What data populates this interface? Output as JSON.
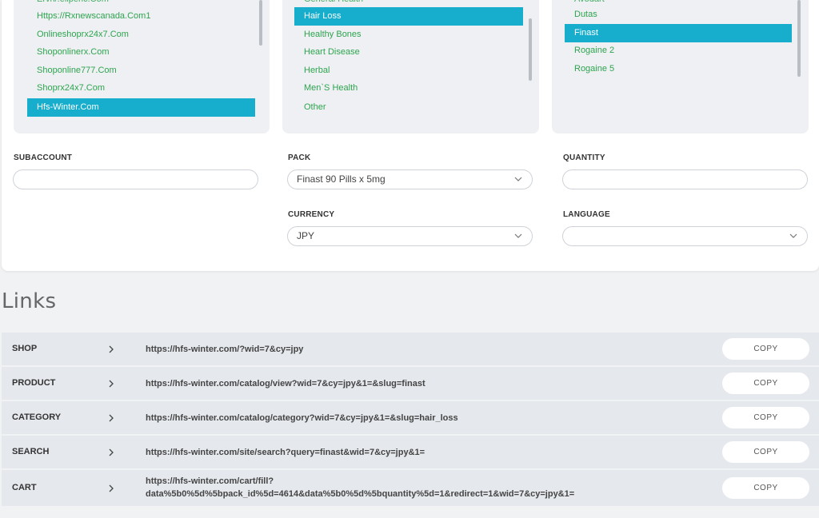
{
  "lists": {
    "shops": {
      "items": [
        "Https://Rxnewscanada.Com1",
        "Onlineshoprx24x7.Com",
        "Shoponlinerx.Com",
        "Shoponline777.Com",
        "Shoprx24x7.Com",
        "Hfs-Winter.Com"
      ],
      "selected": "Hfs-Winter.Com"
    },
    "categories": {
      "items": [
        "Hair Loss",
        "Healthy Bones",
        "Heart Disease",
        "Herbal",
        "Men`S Health",
        "Other"
      ],
      "selected": "Hair Loss"
    },
    "products": {
      "items": [
        "Dutas",
        "Finast",
        "Rogaine 2",
        "Rogaine 5"
      ],
      "selected": "Finast"
    }
  },
  "form": {
    "subaccount": {
      "label": "SUBACCOUNT",
      "value": ""
    },
    "pack": {
      "label": "PACK",
      "value": "Finast 90 Pills x 5mg"
    },
    "quantity": {
      "label": "QUANTITY",
      "value": ""
    },
    "currency": {
      "label": "CURRENCY",
      "value": "JPY"
    },
    "language": {
      "label": "LANGUAGE",
      "value": ""
    }
  },
  "links": {
    "title": "Links",
    "copy_label": "COPY",
    "rows": [
      {
        "name": "SHOP",
        "url_lines": [
          "https://hfs-winter.com/?wid=7&cy=jpy"
        ]
      },
      {
        "name": "PRODUCT",
        "url_lines": [
          "https://hfs-winter.com/catalog/view?wid=7&cy=jpy&1=&slug=finast"
        ]
      },
      {
        "name": "CATEGORY",
        "url_lines": [
          "https://hfs-winter.com/catalog/category?wid=7&cy=jpy&1=&slug=hair_loss"
        ]
      },
      {
        "name": "SEARCH",
        "url_lines": [
          "https://hfs-winter.com/site/search?query=finast&wid=7&cy=jpy&1="
        ]
      },
      {
        "name": "CART",
        "url_lines": [
          "https://hfs-winter.com/cart/fill?",
          "data%5b0%5d%5bpack_id%5d=4614&data%5b0%5d%5bquantity%5d=1&redirect=1&wid=7&cy=jpy&1="
        ]
      }
    ]
  },
  "colors": {
    "accent": "#17aecd",
    "list_text": "#2ea44f",
    "panel_bg": "#eef0f3",
    "row_bg": "#e5e8ec"
  },
  "icons": {
    "chevron": "chevron-down-icon",
    "arrow": "chevron-right-icon"
  }
}
